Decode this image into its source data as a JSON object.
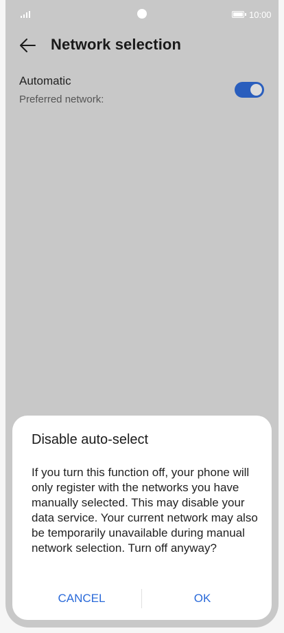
{
  "status_bar": {
    "time": "10:00",
    "icons": [
      "signal-icon",
      "camera-cutout",
      "battery-icon"
    ]
  },
  "header": {
    "back_icon": "back-arrow-icon",
    "title": "Network selection"
  },
  "setting": {
    "title": "Automatic",
    "subtitle": "Preferred network:",
    "toggle_on": true
  },
  "dialog": {
    "title": "Disable auto-select",
    "body": "If you turn this function off, your phone will only register with the networks you have manually selected. This may disable your data service. Your current network may also be temporarily unavailable during manual network selection. Turn off anyway?",
    "cancel_label": "CANCEL",
    "ok_label": "OK"
  },
  "colors": {
    "accent": "#2a6ad9",
    "toggle": "#2a5ebd",
    "scrim": "#c8c8c8"
  }
}
